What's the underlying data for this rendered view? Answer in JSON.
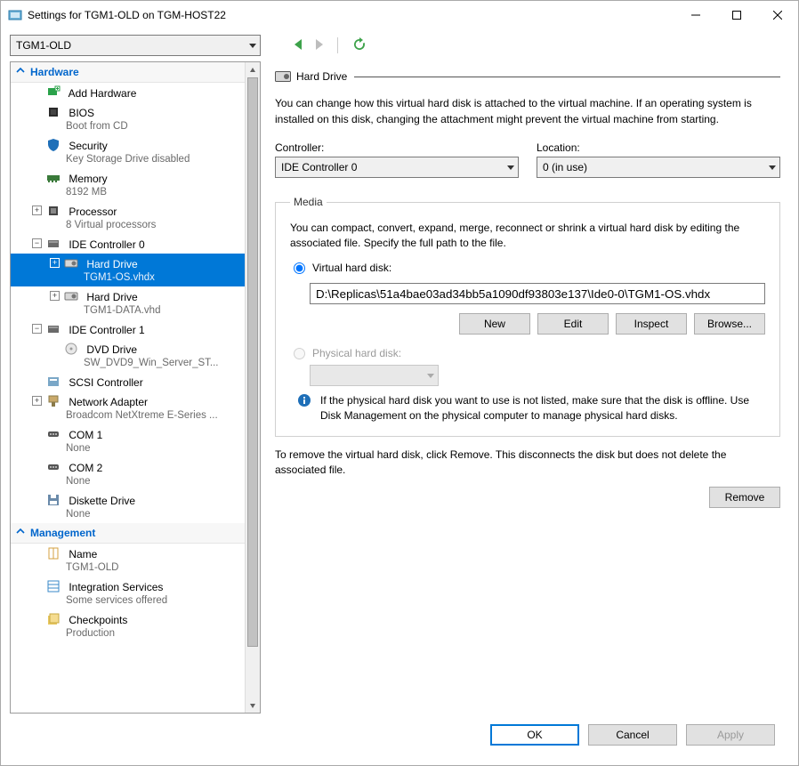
{
  "window": {
    "title": "Settings for TGM1-OLD on TGM-HOST22"
  },
  "vm_selector": {
    "value": "TGM1-OLD"
  },
  "sections": {
    "hardware": "Hardware",
    "management": "Management"
  },
  "tree": {
    "add_hw": "Add Hardware",
    "bios": "BIOS",
    "bios_sub": "Boot from CD",
    "security": "Security",
    "security_sub": "Key Storage Drive disabled",
    "memory": "Memory",
    "memory_sub": "8192 MB",
    "processor": "Processor",
    "processor_sub": "8 Virtual processors",
    "ide0": "IDE Controller 0",
    "hd1": "Hard Drive",
    "hd1_sub": "TGM1-OS.vhdx",
    "hd2": "Hard Drive",
    "hd2_sub": "TGM1-DATA.vhd",
    "ide1": "IDE Controller 1",
    "dvd": "DVD Drive",
    "dvd_sub": "SW_DVD9_Win_Server_ST...",
    "scsi": "SCSI Controller",
    "net": "Network Adapter",
    "net_sub": "Broadcom NetXtreme E-Series ...",
    "com1": "COM 1",
    "com1_sub": "None",
    "com2": "COM 2",
    "com2_sub": "None",
    "diskette": "Diskette Drive",
    "diskette_sub": "None",
    "name": "Name",
    "name_sub": "TGM1-OLD",
    "integ": "Integration Services",
    "integ_sub": "Some services offered",
    "chk": "Checkpoints",
    "chk_sub": "Production"
  },
  "panel": {
    "heading": "Hard Drive",
    "intro": "You can change how this virtual hard disk is attached to the virtual machine. If an operating system is installed on this disk, changing the attachment might prevent the virtual machine from starting.",
    "controller_label": "Controller:",
    "controller_value": "IDE Controller 0",
    "location_label": "Location:",
    "location_value": "0 (in use)",
    "media_legend": "Media",
    "media_text": "You can compact, convert, expand, merge, reconnect or shrink a virtual hard disk by editing the associated file. Specify the full path to the file.",
    "radio_vhd": "Virtual hard disk:",
    "vhd_path": "D:\\Replicas\\51a4bae03ad34bb5a1090df93803e137\\Ide0-0\\TGM1-OS.vhdx",
    "btn_new": "New",
    "btn_edit": "Edit",
    "btn_inspect": "Inspect",
    "btn_browse": "Browse...",
    "radio_phys": "Physical hard disk:",
    "phys_info": "If the physical hard disk you want to use is not listed, make sure that the disk is offline. Use Disk Management on the physical computer to manage physical hard disks.",
    "remove_text": "To remove the virtual hard disk, click Remove. This disconnects the disk but does not delete the associated file.",
    "btn_remove": "Remove"
  },
  "footer": {
    "ok": "OK",
    "cancel": "Cancel",
    "apply": "Apply"
  }
}
